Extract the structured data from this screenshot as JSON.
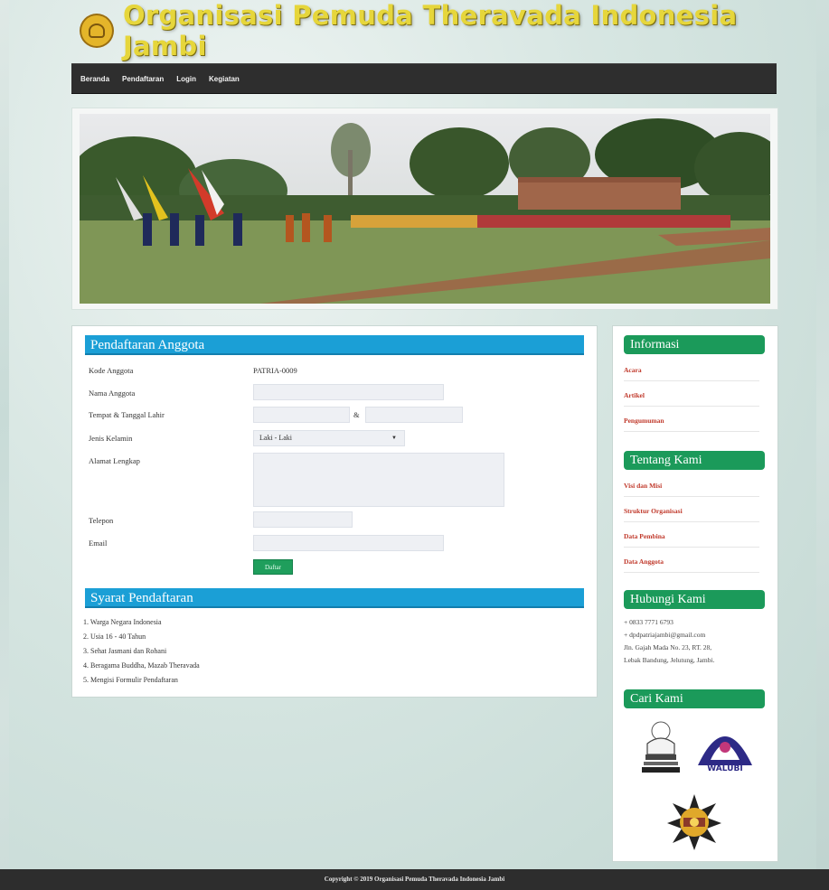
{
  "site": {
    "title": "Organisasi Pemuda Theravada Indonesia Jambi"
  },
  "nav": {
    "items": [
      "Beranda",
      "Pendaftaran",
      "Login",
      "Kegiatan"
    ]
  },
  "form": {
    "heading": "Pendaftaran Anggota",
    "kode_label": "Kode Anggota",
    "kode_value": "PATRIA-0009",
    "nama_label": "Nama Anggota",
    "ttl_label": "Tempat & Tanggal Lahir",
    "ttl_sep": "&",
    "jk_label": "Jenis Kelamin",
    "jk_value": "Laki - Laki",
    "alamat_label": "Alamat Lengkap",
    "telepon_label": "Telepon",
    "email_label": "Email",
    "submit_label": "Daftar"
  },
  "syarat": {
    "heading": "Syarat Pendaftaran",
    "items": [
      "1. Warga Negara Indonesia",
      "2. Usia 16 - 40 Tahun",
      "3. Sehat Jasmani dan Rohani",
      "4. Beragama Buddha, Mazab Theravada",
      "5. Mengisi Formulir Pendaftaran"
    ]
  },
  "sidebar": {
    "informasi_heading": "Informasi",
    "informasi_links": [
      "Acara",
      "Artikel",
      "Pengumuman"
    ],
    "tentang_heading": "Tentang Kami",
    "tentang_links": [
      "Visi dan Misi",
      "Struktur Organisasi",
      "Data Pembina",
      "Data Anggota"
    ],
    "hubungi_heading": "Hubungi Kami",
    "contact_lines": [
      "+ 0833 7771 6793",
      "+ dpdpatriajambi@gmail.com",
      "Jln. Gajah Mada No. 23, RT. 28,",
      "Lebak Bandung, Jelutung, Jambi."
    ],
    "cari_heading": "Cari Kami",
    "logo_walubi_text": "WALUBI"
  },
  "footer": {
    "text": "Copyright © 2019 Organisasi Pemuda Theravada Indonesia Jambi"
  }
}
